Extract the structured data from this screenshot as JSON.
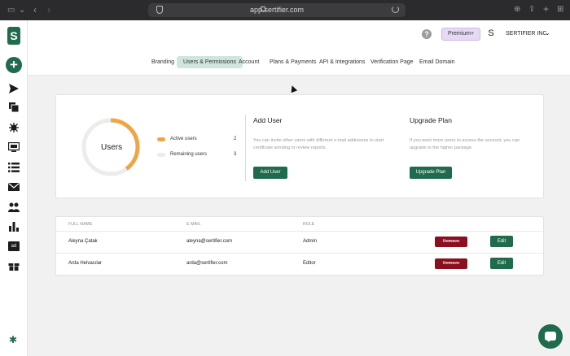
{
  "browser": {
    "url": "app.sertifier.com"
  },
  "sidebar": {
    "logo_letter": "S",
    "add_symbol": "+",
    "icons": [
      "send-icon",
      "copy-icon",
      "settings-bug-icon",
      "monitor-icon",
      "list-icon",
      "mail-icon",
      "users-icon",
      "bar-chart-icon",
      "ad-icon",
      "gift-icon"
    ],
    "ad_text": "ad"
  },
  "header": {
    "help_symbol": "?",
    "premium_label": "Premium+",
    "avatar_letter": "S",
    "org_name": "SERTIFIER INC.",
    "org_chevron": "⌄"
  },
  "tabs": [
    {
      "label": "Branding",
      "active": false
    },
    {
      "label": "Users & Permissions",
      "active": true
    },
    {
      "label": "Account",
      "active": false
    },
    {
      "label": "Plans & Payments",
      "active": false
    },
    {
      "label": "API & Integrations",
      "active": false
    },
    {
      "label": "Verification Page",
      "active": false
    },
    {
      "label": "Email Domain",
      "active": false
    }
  ],
  "users_summary": {
    "title": "Users",
    "active_label": "Active users",
    "active_count": 2,
    "remaining_label": "Remaining users",
    "remaining_count": 3,
    "active_color": "#f0a445",
    "remaining_color": "#ececec"
  },
  "add_user": {
    "title": "Add User",
    "description": "You can invite other users with different e-mail addresses to start certificate sending or review reports.",
    "button_label": "Add User"
  },
  "upgrade_plan": {
    "title": "Upgrade Plan",
    "description": "If you want more users to access the account, you can upgrade to the higher package.",
    "button_label": "Upgrade Plan"
  },
  "users_table": {
    "headers": [
      "FULL NAME",
      "E-MAIL",
      "ROLE"
    ],
    "rows": [
      {
        "name": "Aleyna Çatak",
        "email": "aleyna@sertifier.com",
        "role": "Admin",
        "remove_label": "Remove",
        "edit_label": "Edit"
      },
      {
        "name": "Arda Helvacılar",
        "email": "arda@sertifier.com",
        "role": "Editor",
        "remove_label": "Remove",
        "edit_label": "Edit"
      }
    ]
  },
  "colors": {
    "brand_green": "#1f6b4c",
    "active_tab_bg": "#cfe6dc",
    "premium_bg": "#e5d9f3",
    "remove_red": "#8a1020"
  }
}
